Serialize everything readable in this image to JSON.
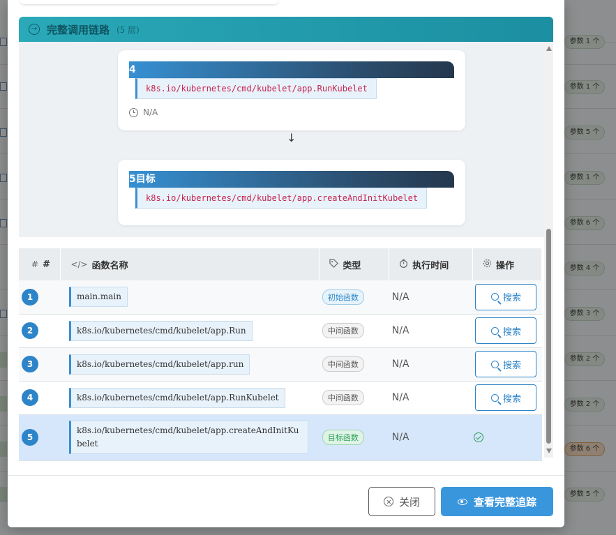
{
  "background": {
    "param_badges": [
      {
        "label": "参数 1 个",
        "highlight": false
      },
      {
        "label": "参数 1 个",
        "highlight": false
      },
      {
        "label": "参数 5 个",
        "highlight": false
      },
      {
        "label": "参数 1 个",
        "highlight": false
      },
      {
        "label": "参数 6 个",
        "highlight": false
      },
      {
        "label": "参数 4 个",
        "highlight": false
      },
      {
        "label": "参数 3 个",
        "highlight": false
      },
      {
        "label": "参数 2 个",
        "highlight": false
      },
      {
        "label": "参数 2 个",
        "highlight": false
      },
      {
        "label": "参数 6 个",
        "highlight": true
      },
      {
        "label": "参数 5 个",
        "highlight": false
      }
    ]
  },
  "chain": {
    "title": "完整调用链路",
    "count": "(5 层)",
    "nodes": [
      {
        "label": "4",
        "func": "k8s.io/kubernetes/cmd/kubelet/app.RunKubelet",
        "time": "N/A"
      },
      {
        "label": "5目标",
        "func": "k8s.io/kubernetes/cmd/kubelet/app.createAndInitKubelet"
      }
    ],
    "arrow": "↓"
  },
  "table": {
    "headers": {
      "index_icon": "#",
      "index": "#",
      "name_icon": "</>",
      "name": "函数名称",
      "type": "类型",
      "time": "执行时间",
      "action": "操作"
    },
    "rows": [
      {
        "index": "1",
        "func": "main.main",
        "type": "初始函数",
        "type_kind": "init",
        "time": "N/A",
        "action": "搜索"
      },
      {
        "index": "2",
        "func": "k8s.io/kubernetes/cmd/kubelet/app.Run",
        "type": "中间函数",
        "type_kind": "mid",
        "time": "N/A",
        "action": "搜索"
      },
      {
        "index": "3",
        "func": "k8s.io/kubernetes/cmd/kubelet/app.run",
        "type": "中间函数",
        "type_kind": "mid",
        "time": "N/A",
        "action": "搜索"
      },
      {
        "index": "4",
        "func": "k8s.io/kubernetes/cmd/kubelet/app.RunKubelet",
        "type": "中间函数",
        "type_kind": "mid",
        "time": "N/A",
        "action": "搜索"
      },
      {
        "index": "5",
        "func": "k8s.io/kubernetes/cmd/kubelet/app.createAndInitKubelet",
        "type": "目标函数",
        "type_kind": "goal",
        "time": "N/A",
        "action": ""
      }
    ]
  },
  "footer": {
    "close_label": "关闭",
    "trace_label": "查看完整追踪"
  },
  "colors": {
    "accent": "#3a96dc",
    "header_teal": "#1b8fa1",
    "target_row": "#d6e6fb"
  }
}
